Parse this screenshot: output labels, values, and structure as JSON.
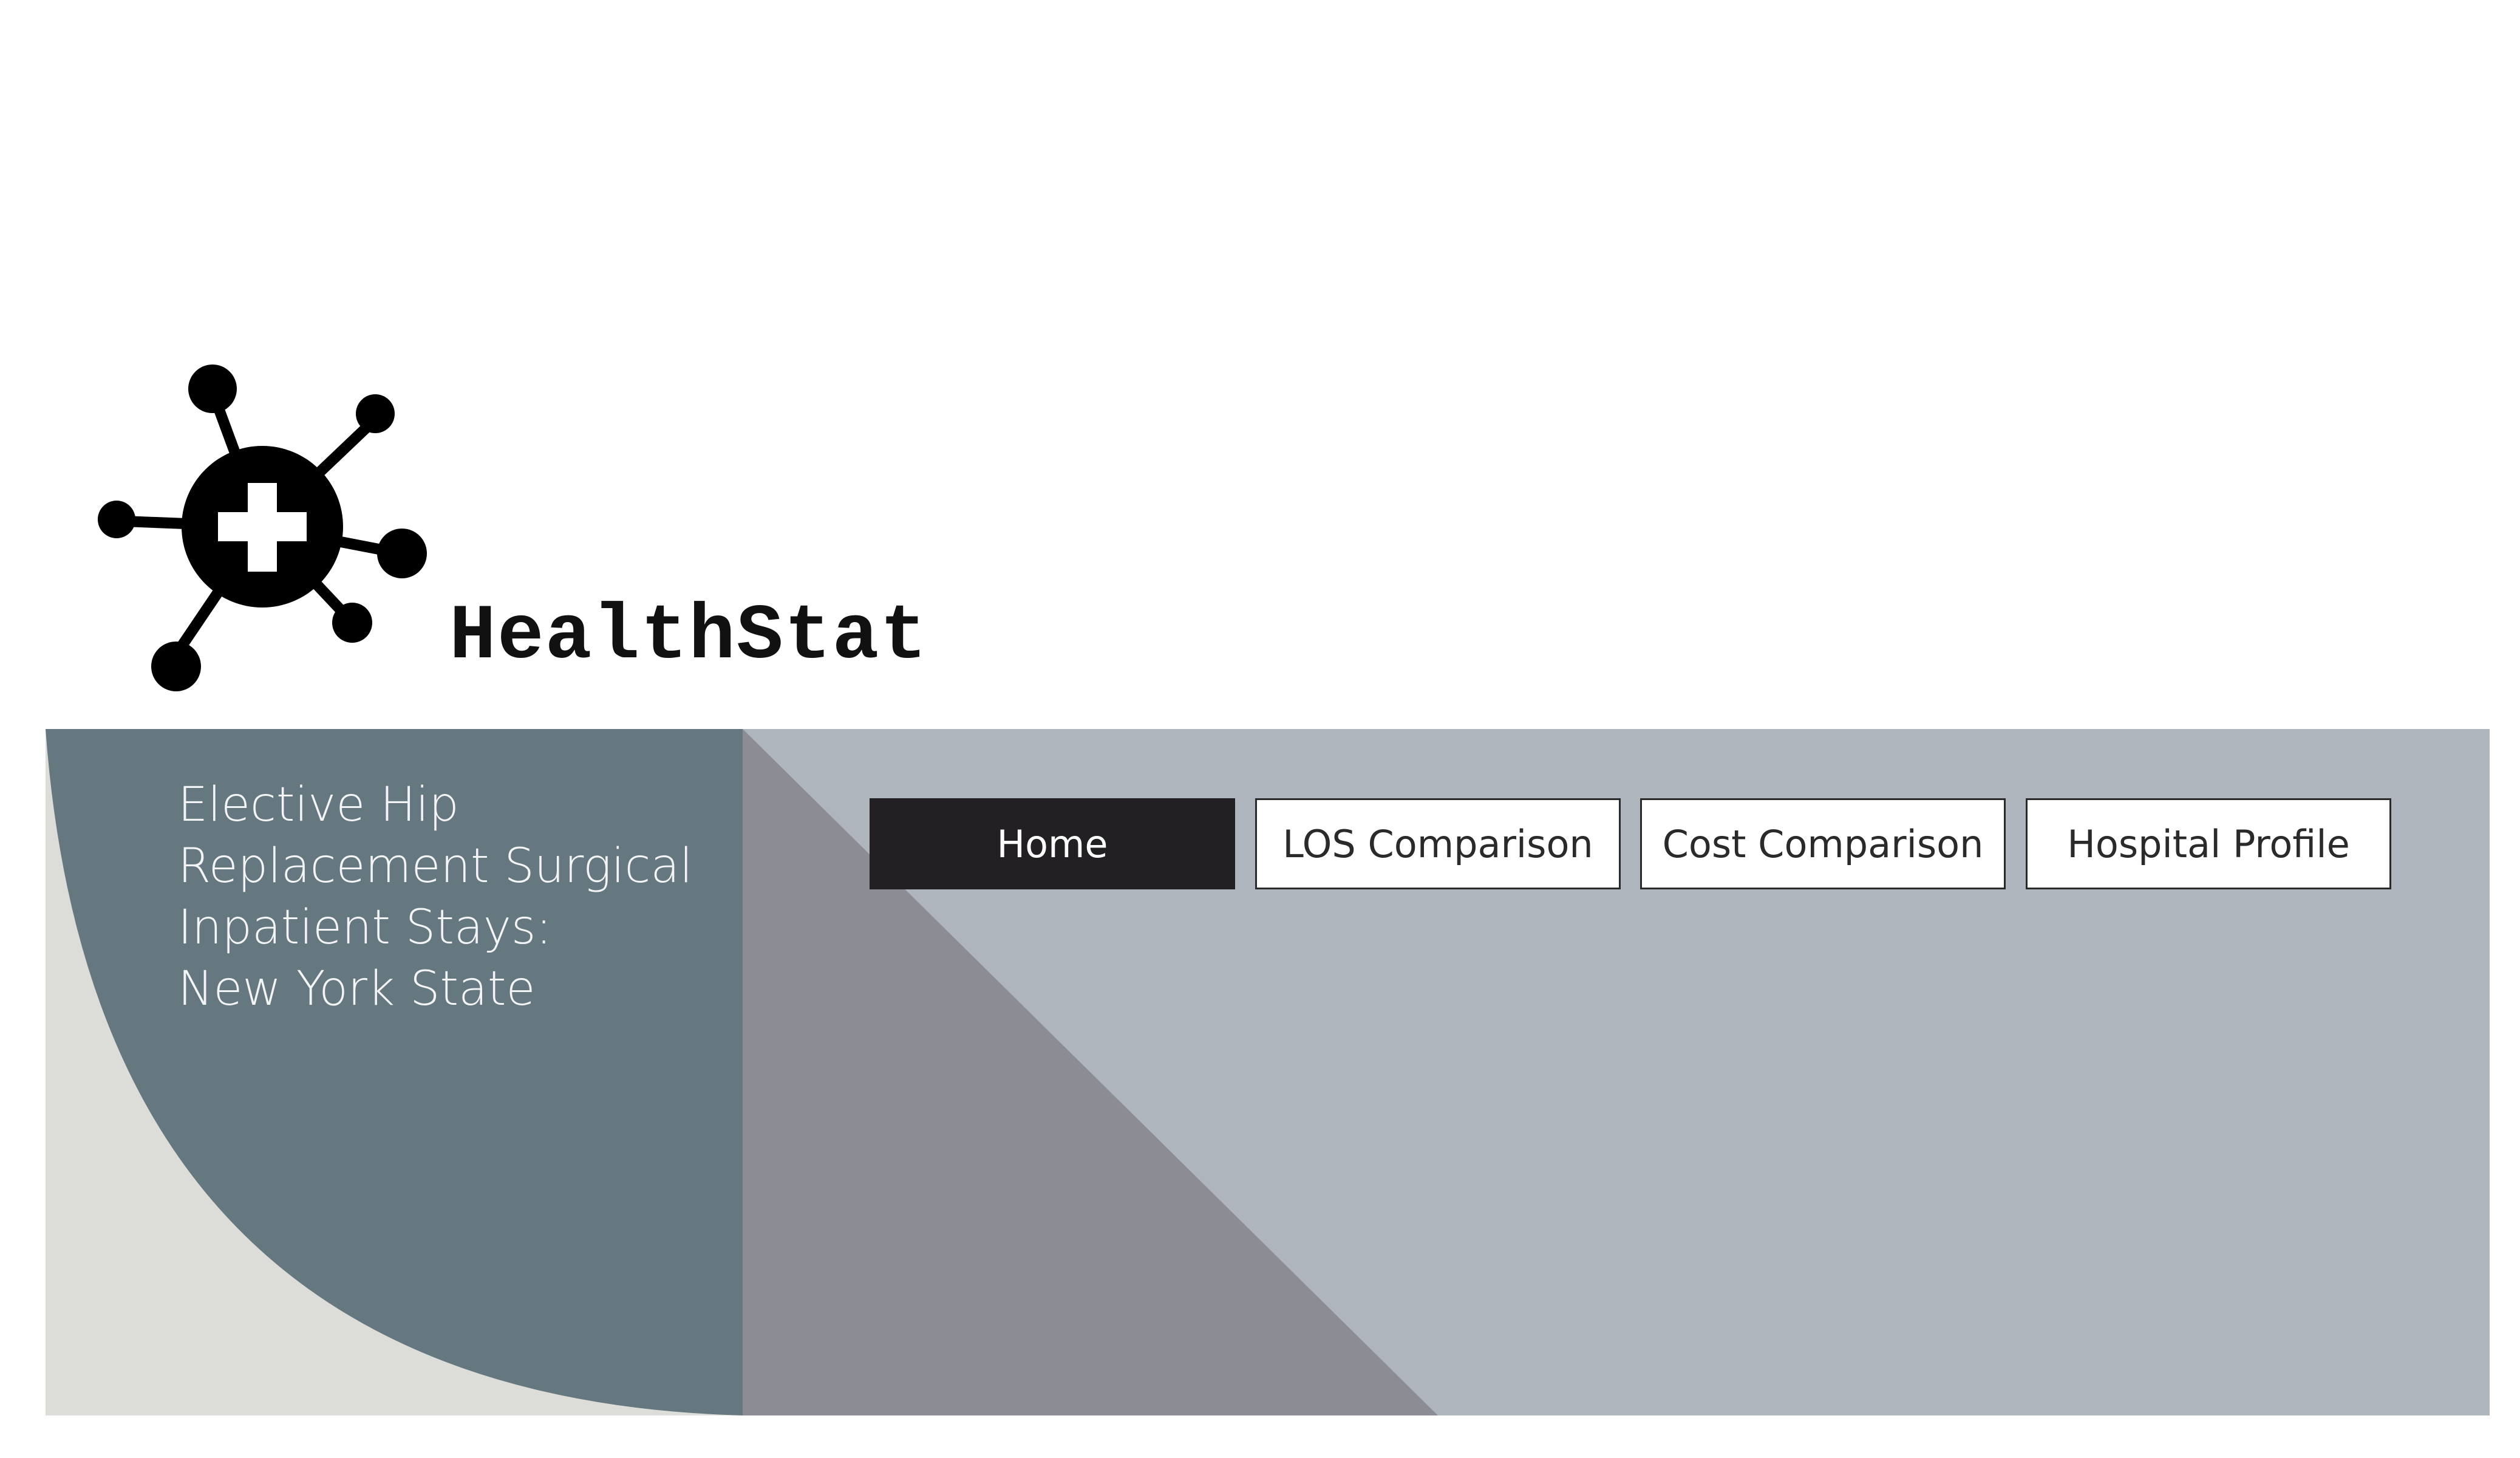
{
  "brand": {
    "name": "HealthStat",
    "logo_icon": "medical-cross-network-icon"
  },
  "banner": {
    "title_lines": [
      "Elective Hip",
      "Replacement Surgical",
      "Inpatient Stays:",
      "New York State"
    ]
  },
  "nav": {
    "items": [
      {
        "label": "Home",
        "active": true
      },
      {
        "label": "LOS Comparison",
        "active": false
      },
      {
        "label": "Cost Comparison",
        "active": false
      },
      {
        "label": "Hospital Profile",
        "active": false
      }
    ]
  },
  "colors": {
    "banner_teal": "#657880",
    "banner_light": "#dcdcd8",
    "banner_right": "#afb5bd",
    "banner_triangle": "#8c8c95",
    "active_button": "#222022"
  }
}
